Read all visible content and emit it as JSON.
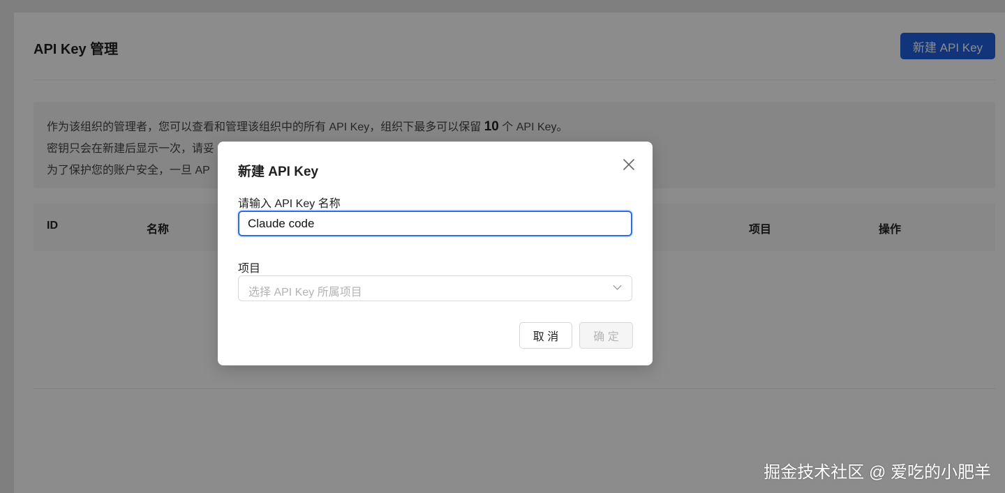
{
  "page": {
    "title": "API Key 管理",
    "new_button_label": "新建 API Key"
  },
  "notice": {
    "line1_prefix": "作为该组织的管理者，您可以查看和管理该组织中的所有 API Key，组织下最多可以保留 ",
    "line1_count": "10",
    "line1_suffix": " 个 API Key。",
    "line2": "密钥只会在新建后显示一次，请妥",
    "line3": "为了保护您的账户安全，一旦 AP"
  },
  "table": {
    "columns": [
      "ID",
      "名称",
      "项目",
      "操作"
    ]
  },
  "modal": {
    "title": "新建 API Key",
    "name_label": "请输入 API Key 名称",
    "name_value": "Claude code",
    "project_label": "项目",
    "project_placeholder": "选择 API Key 所属项目",
    "cancel_label": "取 消",
    "ok_label": "确 定"
  },
  "watermark": "掘金技术社区 @ 爱吃的小肥羊",
  "colors": {
    "primary": "#1f5fe0",
    "focus": "#2f6be6",
    "mask": "rgba(0,0,0,0.45)"
  },
  "icons": {
    "close": "close-icon",
    "dropdown": "chevron-down-icon"
  }
}
